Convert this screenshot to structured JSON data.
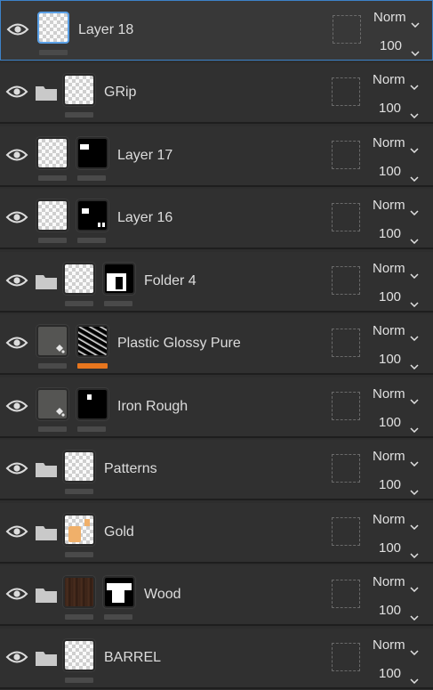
{
  "layers": [
    {
      "name": "Layer 18",
      "blend": "Norm",
      "opacity": "100",
      "selected": true,
      "kind": "layer",
      "thumb": "checker"
    },
    {
      "name": "GRip",
      "blend": "Norm",
      "opacity": "100",
      "selected": false,
      "kind": "folder",
      "thumb": "checker"
    },
    {
      "name": "Layer 17",
      "blend": "Norm",
      "opacity": "100",
      "selected": false,
      "kind": "layer-mask",
      "thumb": "checker"
    },
    {
      "name": "Layer 16",
      "blend": "Norm",
      "opacity": "100",
      "selected": false,
      "kind": "layer-mask",
      "thumb": "checker"
    },
    {
      "name": "Folder 4",
      "blend": "Norm",
      "opacity": "100",
      "selected": false,
      "kind": "folder-mask",
      "thumb": "checker"
    },
    {
      "name": "Plastic Glossy Pure",
      "blend": "Norm",
      "opacity": "100",
      "selected": false,
      "kind": "fill-mask",
      "thumb": "material",
      "accent": "#e8761e"
    },
    {
      "name": "Iron Rough",
      "blend": "Norm",
      "opacity": "100",
      "selected": false,
      "kind": "fill-mask",
      "thumb": "material"
    },
    {
      "name": "Patterns",
      "blend": "Norm",
      "opacity": "100",
      "selected": false,
      "kind": "folder",
      "thumb": "checker"
    },
    {
      "name": "Gold",
      "blend": "Norm",
      "opacity": "100",
      "selected": false,
      "kind": "folder",
      "thumb": "gold"
    },
    {
      "name": "Wood",
      "blend": "Norm",
      "opacity": "100",
      "selected": false,
      "kind": "folder-mask",
      "thumb": "wood"
    },
    {
      "name": "BARREL",
      "blend": "Norm",
      "opacity": "100",
      "selected": false,
      "kind": "folder",
      "thumb": "checker"
    }
  ],
  "icons": {
    "visibility": "eye-icon",
    "folder": "folder-icon",
    "dropdown": "chevron-down-icon"
  },
  "colors": {
    "selection": "#3c82c8",
    "background": "#303030",
    "accent": "#e8761e"
  }
}
